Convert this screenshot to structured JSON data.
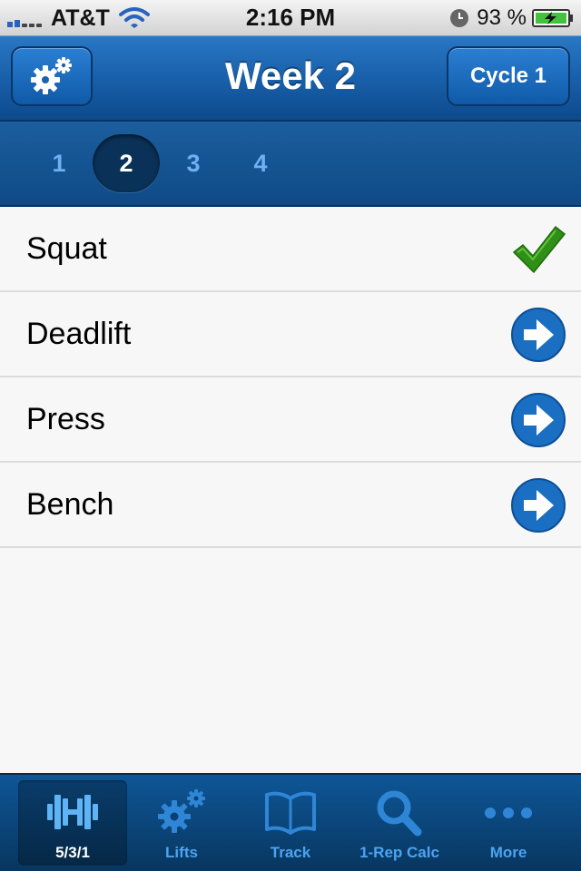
{
  "status_bar": {
    "carrier": "AT&T",
    "time": "2:16 PM",
    "battery_percent": "93 %"
  },
  "nav": {
    "title": "Week 2",
    "cycle_label": "Cycle 1"
  },
  "weeks": {
    "items": [
      "1",
      "2",
      "3",
      "4"
    ],
    "selected": "2"
  },
  "lifts": [
    {
      "name": "Squat",
      "status": "complete",
      "icon": "checkmark-icon"
    },
    {
      "name": "Deadlift",
      "status": "pending",
      "icon": "arrow-right-icon"
    },
    {
      "name": "Press",
      "status": "pending",
      "icon": "arrow-right-icon"
    },
    {
      "name": "Bench",
      "status": "pending",
      "icon": "arrow-right-icon"
    }
  ],
  "tabs": [
    {
      "label": "5/3/1",
      "icon": "barbell-icon",
      "active": true
    },
    {
      "label": "Lifts",
      "icon": "gears-icon",
      "active": false
    },
    {
      "label": "Track",
      "icon": "book-icon",
      "active": false
    },
    {
      "label": "1-Rep Calc",
      "icon": "search-icon",
      "active": false
    },
    {
      "label": "More",
      "icon": "more-dots-icon",
      "active": false
    }
  ],
  "colors": {
    "nav_blue": "#1a62ad",
    "tab_inactive": "#4da3f0",
    "check_green": "#3a9a1e",
    "arrow_button_blue": "#1b6fc2"
  }
}
